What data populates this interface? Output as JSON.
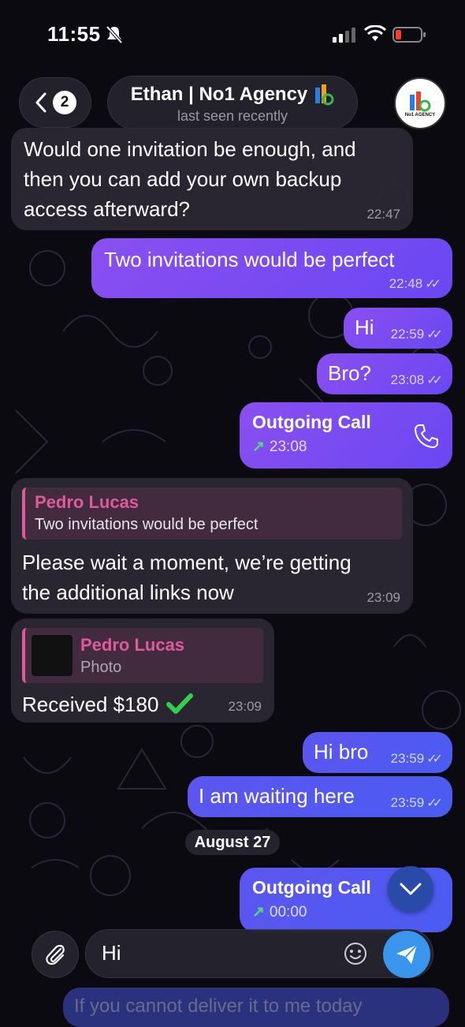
{
  "status_bar": {
    "time": "11:55",
    "icons": [
      "mute-bell-icon",
      "signal-icon",
      "wifi-icon",
      "battery-low-icon"
    ]
  },
  "header": {
    "back_count": "2",
    "chat_name": "Ethan | No1 Agency",
    "chat_status": "last seen recently",
    "avatar_brand": "No1 AGENCY"
  },
  "messages": [
    {
      "dir": "in",
      "text_lines": [
        "Would one invitation be enough, and",
        "then you can add your own backup",
        "access afterward?"
      ],
      "time": "22:47"
    },
    {
      "dir": "out",
      "text": "Two invitations would be perfect",
      "time": "22:48"
    },
    {
      "dir": "out",
      "text": "Hi",
      "time": "22:59"
    },
    {
      "dir": "out",
      "text": "Bro?",
      "time": "23:08"
    },
    {
      "dir": "out",
      "type": "call",
      "title": "Outgoing Call",
      "time": "23:08"
    },
    {
      "dir": "in",
      "reply_author": "Pedro Lucas",
      "reply_text": "Two invitations would be perfect",
      "text_lines": [
        "Please wait a moment, we’re getting",
        "the additional links now"
      ],
      "time": "23:09"
    },
    {
      "dir": "in",
      "reply_author": "Pedro Lucas",
      "reply_text": "Photo",
      "text": "Received $180",
      "time": "23:09"
    },
    {
      "dir": "out",
      "text": "Hi bro",
      "time": "23:59"
    },
    {
      "dir": "out",
      "text": "I am waiting here",
      "time": "23:59"
    },
    {
      "dir": "out",
      "type": "call",
      "title": "Outgoing Call",
      "time": "00:00"
    }
  ],
  "date_separator": "August 27",
  "input": {
    "value": "Hi"
  },
  "peek_text": "If you cannot deliver it to me today",
  "colors": {
    "outgoing": "#7b4cf1",
    "incoming": "#2c2834",
    "accent_pink": "#e0599a",
    "send": "#3a96ec"
  }
}
